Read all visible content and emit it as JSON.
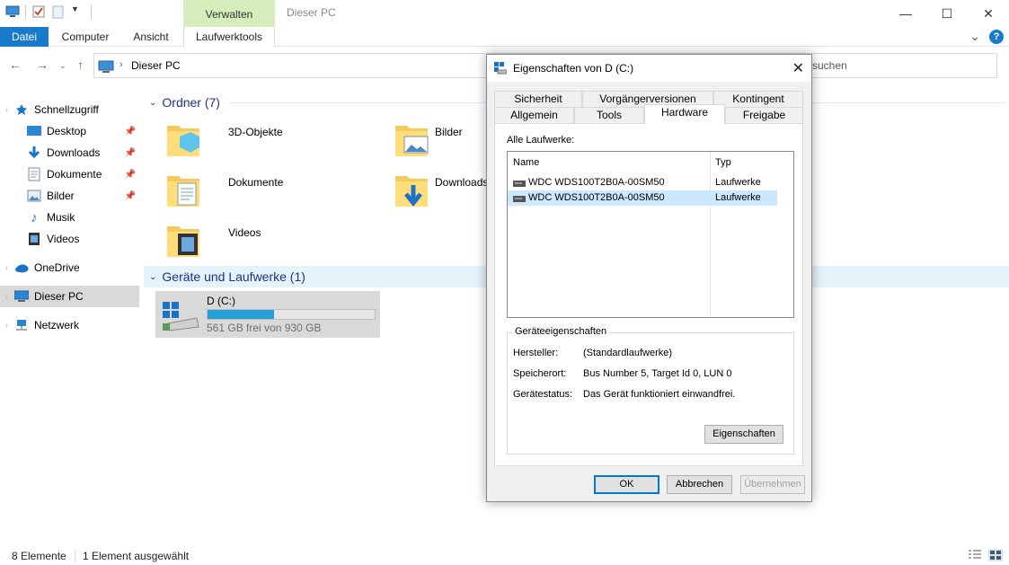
{
  "titlebar": {
    "context_tab": "Verwalten",
    "window_title": "Dieser PC",
    "minimize": "—",
    "maximize": "☐",
    "close": "✕"
  },
  "ribbon": {
    "tabs": [
      "Datei",
      "Computer",
      "Ansicht",
      "Laufwerktools"
    ],
    "expand": "⌄",
    "help": "?"
  },
  "address": {
    "crumb": "Dieser PC",
    "search_placeholder": "suchen"
  },
  "nav": {
    "items": [
      {
        "label": "Schnellzugriff",
        "icon": "star-icon"
      },
      {
        "label": "Desktop",
        "icon": "desktop-icon",
        "pinned": true
      },
      {
        "label": "Downloads",
        "icon": "download-icon",
        "pinned": true
      },
      {
        "label": "Dokumente",
        "icon": "document-icon",
        "pinned": true
      },
      {
        "label": "Bilder",
        "icon": "picture-icon",
        "pinned": true
      },
      {
        "label": "Musik",
        "icon": "music-icon"
      },
      {
        "label": "Videos",
        "icon": "video-icon"
      },
      {
        "label": "OneDrive",
        "icon": "cloud-icon"
      },
      {
        "label": "Dieser PC",
        "icon": "computer-icon",
        "selected": true
      },
      {
        "label": "Netzwerk",
        "icon": "network-icon"
      }
    ]
  },
  "content": {
    "folders_header": "Ordner (7)",
    "folders": [
      "3D-Objekte",
      "Bilder",
      "Dokumente",
      "Downloads",
      "Videos"
    ],
    "devices_header": "Geräte und Laufwerke (1)",
    "drive": {
      "name": "D (C:)",
      "free_text": "561 GB frei von 930 GB",
      "used_fraction": 0.397
    }
  },
  "status": {
    "count": "8 Elemente",
    "selection": "1 Element ausgewählt"
  },
  "dialog": {
    "title": "Eigenschaften von D (C:)",
    "tabs_row1": [
      "Sicherheit",
      "Vorgängerversionen",
      "Kontingent"
    ],
    "tabs_row2": [
      "Allgemein",
      "Tools",
      "Hardware",
      "Freigabe"
    ],
    "active_tab": "Hardware",
    "all_drives_label": "Alle Laufwerke:",
    "col_name": "Name",
    "col_type": "Typ",
    "drives": [
      {
        "name": "WDC  WDS100T2B0A-00SM50",
        "type": "Laufwerke"
      },
      {
        "name": "WDC  WDS100T2B0A-00SM50",
        "type": "Laufwerke"
      }
    ],
    "props_legend": "Geräteeigenschaften",
    "props": [
      {
        "label": "Hersteller:",
        "value": "(Standardlaufwerke)"
      },
      {
        "label": "Speicherort:",
        "value": "Bus Number 5, Target Id 0, LUN 0"
      },
      {
        "label": "Gerätestatus:",
        "value": "Das Gerät funktioniert einwandfrei."
      }
    ],
    "props_button": "Eigenschaften",
    "ok": "OK",
    "cancel": "Abbrechen",
    "apply": "Übernehmen"
  }
}
